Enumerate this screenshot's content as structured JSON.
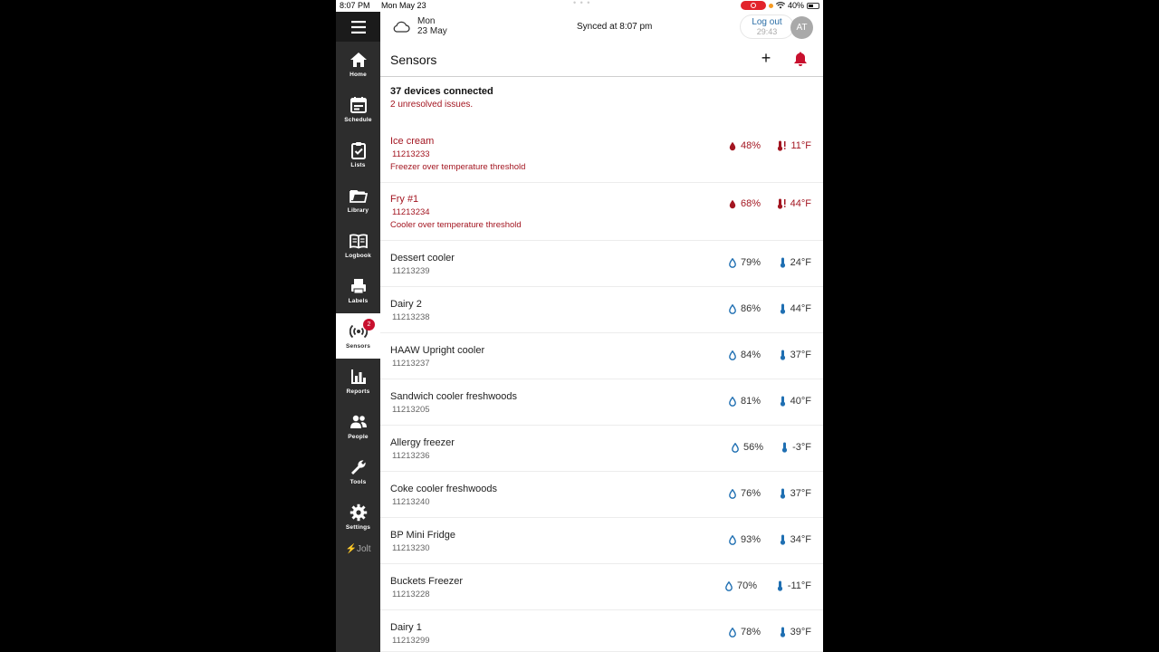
{
  "status_bar": {
    "time": "8:07 PM",
    "date": "Mon May 23",
    "battery": "40%"
  },
  "header": {
    "weather_day": "Mon",
    "weather_date": "23 May",
    "synced": "Synced at 8:07 pm",
    "logout_label": "Log out",
    "logout_timer": "29:43",
    "avatar_initials": "AT"
  },
  "sidebar": {
    "items": [
      {
        "label": "Home",
        "icon": "home-icon"
      },
      {
        "label": "Schedule",
        "icon": "calendar-icon"
      },
      {
        "label": "Lists",
        "icon": "clipboard-check-icon"
      },
      {
        "label": "Library",
        "icon": "folder-icon"
      },
      {
        "label": "Logbook",
        "icon": "book-icon"
      },
      {
        "label": "Labels",
        "icon": "printer-icon"
      },
      {
        "label": "Sensors",
        "icon": "broadcast-icon",
        "badge": "2",
        "active": true
      },
      {
        "label": "Reports",
        "icon": "bar-chart-icon"
      },
      {
        "label": "People",
        "icon": "people-icon"
      },
      {
        "label": "Tools",
        "icon": "wrench-icon"
      },
      {
        "label": "Settings",
        "icon": "gear-icon"
      }
    ],
    "brand": "Jolt"
  },
  "page": {
    "title": "Sensors"
  },
  "summary": {
    "title": "37 devices connected",
    "issues": "2 unresolved issues."
  },
  "colors": {
    "issue_red": "#a31621",
    "normal_blue": "#1f6fb2",
    "sidebar_bg": "#2d2d2d"
  },
  "sensors": [
    {
      "name": "Ice cream",
      "id": "11213233",
      "alert": "Freezer over temperature threshold",
      "humidity": "48%",
      "temp": "11°F",
      "issue": true
    },
    {
      "name": "Fry #1",
      "id": "11213234",
      "alert": "Cooler over temperature threshold",
      "humidity": "68%",
      "temp": "44°F",
      "issue": true
    },
    {
      "name": "Dessert cooler",
      "id": "11213239",
      "humidity": "79%",
      "temp": "24°F"
    },
    {
      "name": "Dairy 2",
      "id": "11213238",
      "humidity": "86%",
      "temp": "44°F"
    },
    {
      "name": "HAAW Upright cooler",
      "id": "11213237",
      "humidity": "84%",
      "temp": "37°F"
    },
    {
      "name": "Sandwich cooler freshwoods",
      "id": "11213205",
      "humidity": "81%",
      "temp": "40°F"
    },
    {
      "name": "Allergy freezer",
      "id": "11213236",
      "humidity": "56%",
      "temp": "-3°F"
    },
    {
      "name": "Coke cooler freshwoods",
      "id": "11213240",
      "humidity": "76%",
      "temp": "37°F"
    },
    {
      "name": "BP Mini Fridge",
      "id": "11213230",
      "humidity": "93%",
      "temp": "34°F"
    },
    {
      "name": "Buckets Freezer",
      "id": "11213228",
      "humidity": "70%",
      "temp": "-11°F"
    },
    {
      "name": "Dairy 1",
      "id": "11213299",
      "humidity": "78%",
      "temp": "39°F"
    }
  ]
}
